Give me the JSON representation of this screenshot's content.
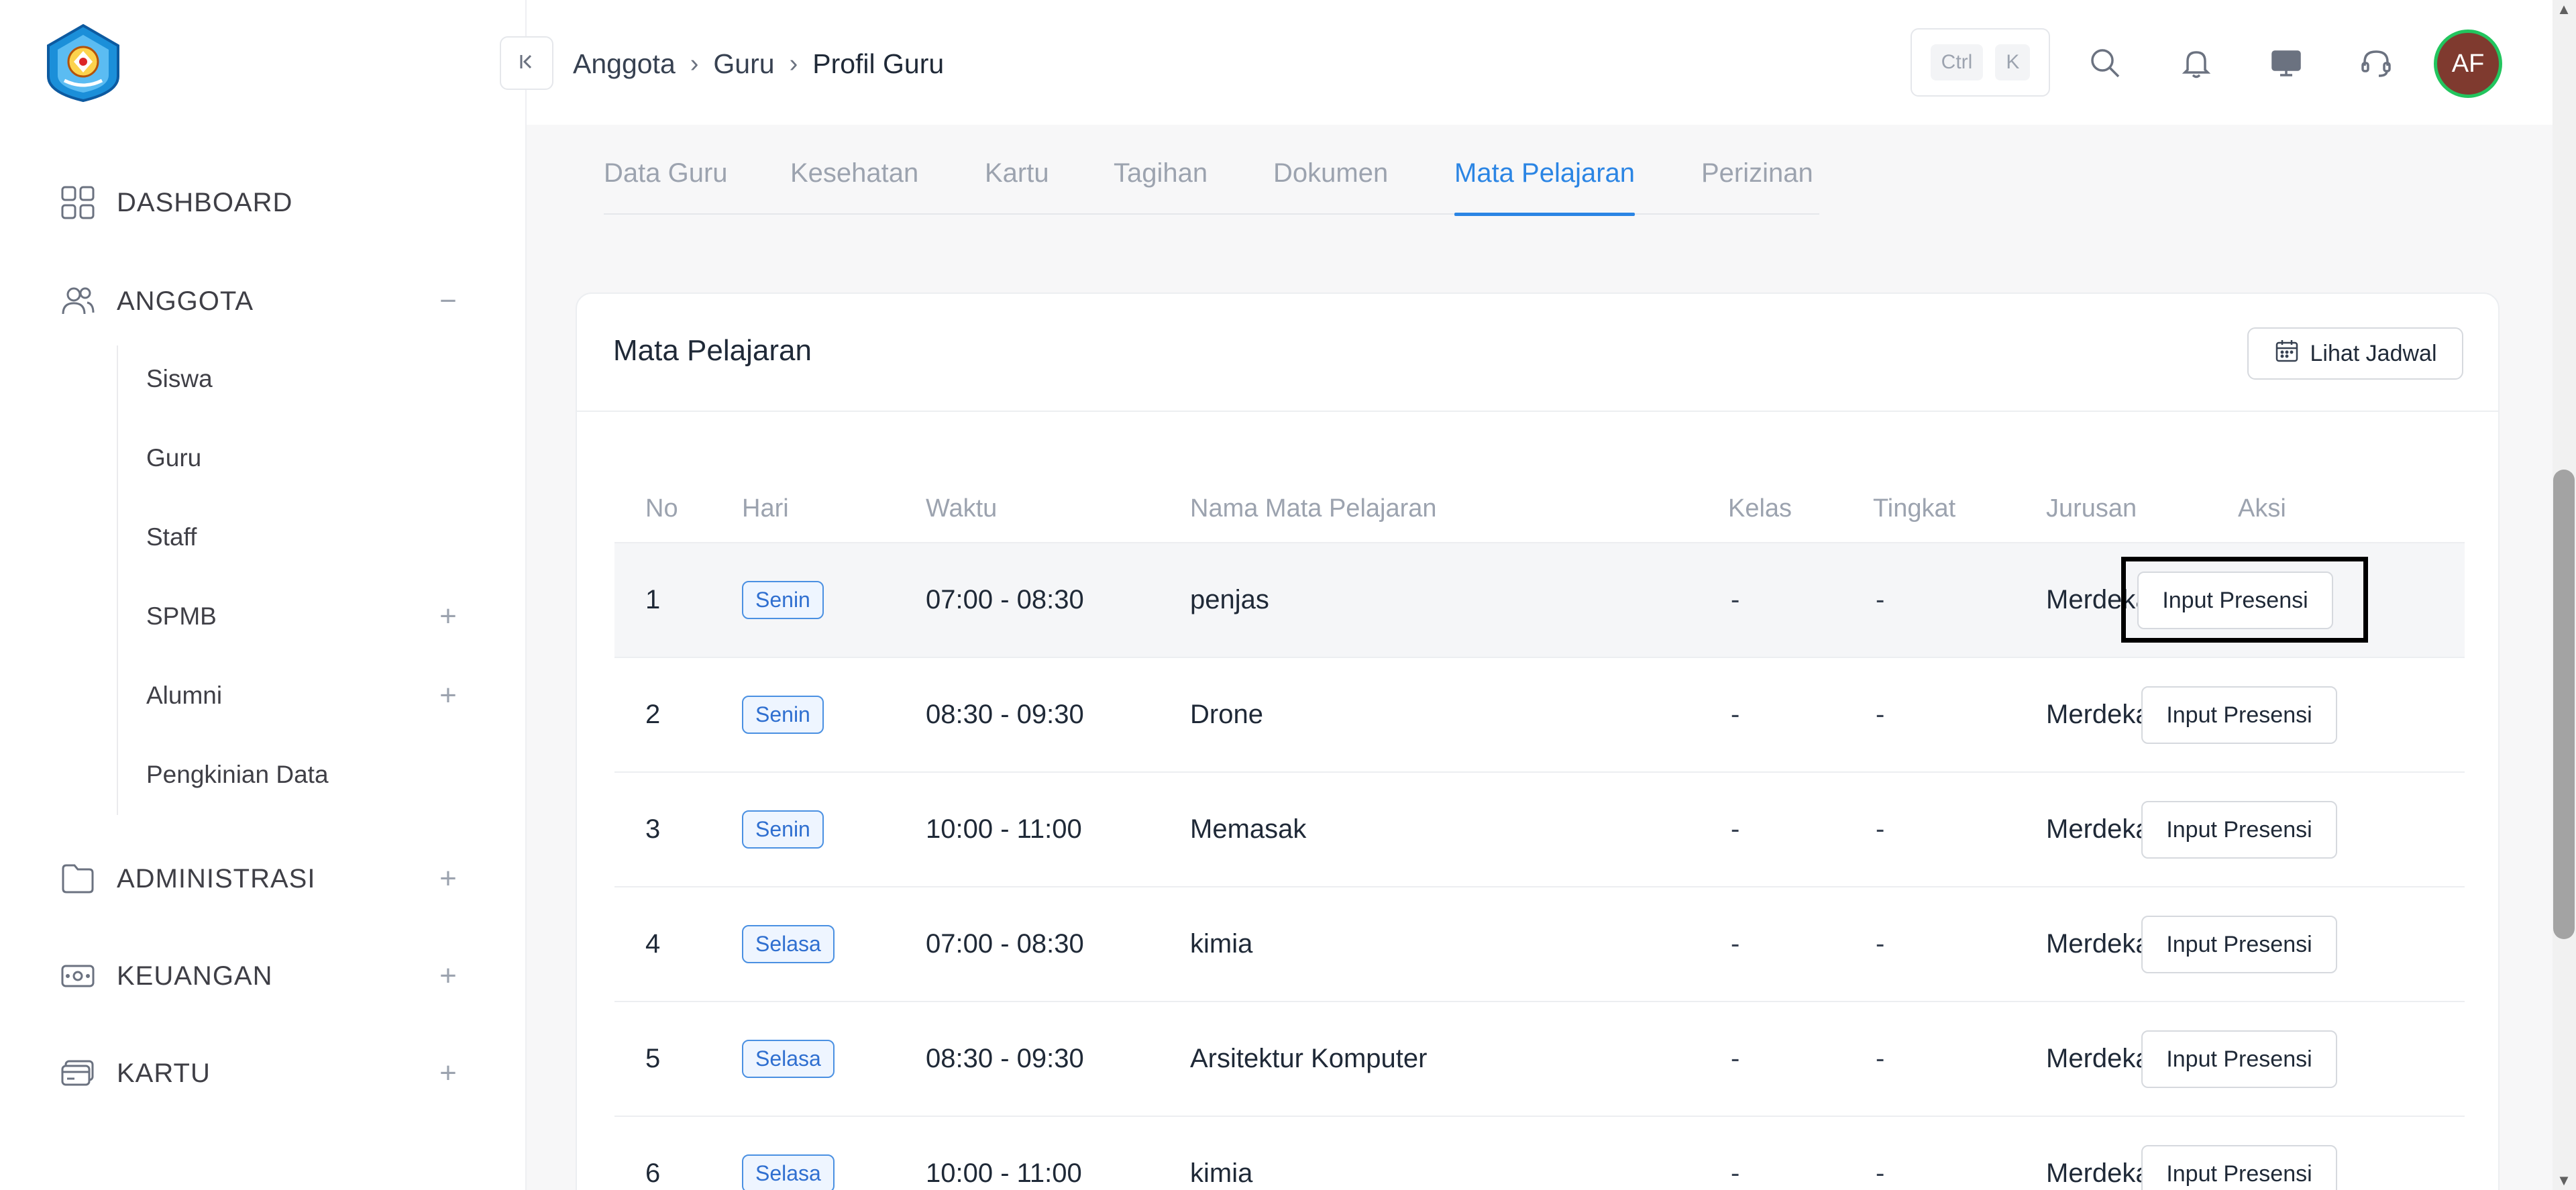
{
  "sidebar": {
    "items": [
      {
        "label": "DASHBOARD",
        "icon": "dashboard-grid-icon"
      },
      {
        "label": "ANGGOTA",
        "icon": "users-icon",
        "toggle": "−"
      },
      {
        "label": "ADMINISTRASI",
        "icon": "folder-icon",
        "toggle": "+"
      },
      {
        "label": "KEUANGAN",
        "icon": "money-icon",
        "toggle": "+"
      },
      {
        "label": "KARTU",
        "icon": "card-icon",
        "toggle": "+"
      }
    ],
    "anggota_children": [
      {
        "label": "Siswa"
      },
      {
        "label": "Guru"
      },
      {
        "label": "Staff"
      },
      {
        "label": "SPMB",
        "toggle": "+"
      },
      {
        "label": "Alumni",
        "toggle": "+"
      },
      {
        "label": "Pengkinian Data"
      }
    ]
  },
  "header": {
    "breadcrumb": [
      "Anggota",
      "Guru",
      "Profil Guru"
    ],
    "shortcut": {
      "ctrl": "Ctrl",
      "key": "K"
    },
    "avatar_initials": "AF"
  },
  "tabs": [
    {
      "label": "Data Guru"
    },
    {
      "label": "Kesehatan"
    },
    {
      "label": "Kartu"
    },
    {
      "label": "Tagihan"
    },
    {
      "label": "Dokumen"
    },
    {
      "label": "Mata Pelajaran",
      "active": true
    },
    {
      "label": "Perizinan"
    }
  ],
  "card": {
    "title": "Mata Pelajaran",
    "view_schedule_label": "Lihat Jadwal"
  },
  "table": {
    "columns": [
      "No",
      "Hari",
      "Waktu",
      "Nama Mata Pelajaran",
      "Kelas",
      "Tingkat",
      "Jurusan",
      "Aksi"
    ],
    "action_label": "Input Presensi",
    "rows": [
      {
        "no": "1",
        "hari": "Senin",
        "waktu": "07:00 - 08:30",
        "nama": "penjas",
        "kelas": "-",
        "tingkat": "-",
        "jurusan": "Merdeka"
      },
      {
        "no": "2",
        "hari": "Senin",
        "waktu": "08:30 - 09:30",
        "nama": "Drone",
        "kelas": "-",
        "tingkat": "-",
        "jurusan": "Merdeka"
      },
      {
        "no": "3",
        "hari": "Senin",
        "waktu": "10:00 - 11:00",
        "nama": "Memasak",
        "kelas": "-",
        "tingkat": "-",
        "jurusan": "Merdeka"
      },
      {
        "no": "4",
        "hari": "Selasa",
        "waktu": "07:00 - 08:30",
        "nama": "kimia",
        "kelas": "-",
        "tingkat": "-",
        "jurusan": "Merdeka"
      },
      {
        "no": "5",
        "hari": "Selasa",
        "waktu": "08:30 - 09:30",
        "nama": "Arsitektur Komputer",
        "kelas": "-",
        "tingkat": "-",
        "jurusan": "Merdeka"
      },
      {
        "no": "6",
        "hari": "Selasa",
        "waktu": "10:00 - 11:00",
        "nama": "kimia",
        "kelas": "-",
        "tingkat": "-",
        "jurusan": "Merdeka"
      }
    ]
  },
  "colors": {
    "accent": "#2b85e4",
    "badge_border": "#4a90e2",
    "avatar_bg": "#7f3a2f",
    "avatar_ring": "#22c55e"
  }
}
